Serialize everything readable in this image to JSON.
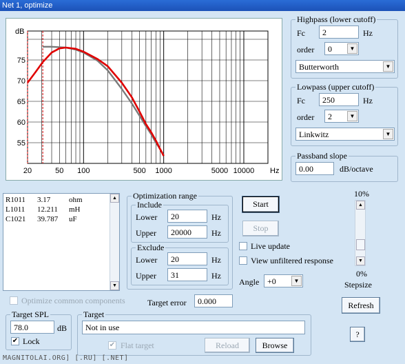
{
  "window": {
    "title": "Net 1, optimize"
  },
  "chart_data": {
    "type": "line",
    "xscale": "log",
    "ylabel": "dB",
    "xlabel": "Hz",
    "xlim": [
      20,
      20000
    ],
    "ylim": [
      50,
      82
    ],
    "x_ticks": [
      "20",
      "50",
      "100",
      "500",
      "1000",
      "5000",
      "10000"
    ],
    "y_ticks": [
      "75",
      "70",
      "65",
      "60",
      "55"
    ],
    "excluded_band_hz": [
      20,
      31
    ],
    "series": [
      {
        "color": "#7a7a7a",
        "x": [
          31,
          40,
          60,
          80,
          100,
          150,
          200,
          300,
          400,
          500,
          600,
          700,
          800,
          900,
          1000
        ],
        "y": [
          78.2,
          78.2,
          78.0,
          77.5,
          76.8,
          74.8,
          72.5,
          68.0,
          64.5,
          61.5,
          59.0,
          57.0,
          55.0,
          53.5,
          52.0
        ]
      },
      {
        "color": "#e00000",
        "x": [
          20,
          25,
          31,
          40,
          50,
          60,
          80,
          100,
          150,
          200,
          300,
          400,
          500,
          600,
          700,
          800,
          900,
          1000
        ],
        "y": [
          69.5,
          72.0,
          74.5,
          76.8,
          77.8,
          78.0,
          77.7,
          77.0,
          75.2,
          73.5,
          69.5,
          66.0,
          62.5,
          59.5,
          57.5,
          55.5,
          53.5,
          51.8
        ]
      }
    ]
  },
  "highpass": {
    "legend": "Highpass (lower cutoff)",
    "fc_label": "Fc",
    "fc_value": "2",
    "fc_unit": "Hz",
    "order_label": "order",
    "order_value": "0",
    "type_value": "Butterworth"
  },
  "lowpass": {
    "legend": "Lowpass (upper cutoff)",
    "fc_label": "Fc",
    "fc_value": "250",
    "fc_unit": "Hz",
    "order_label": "order",
    "order_value": "2",
    "type_value": "Linkwitz"
  },
  "passband": {
    "legend": "Passband slope",
    "value": "0.00",
    "unit": "dB/octave"
  },
  "components": [
    {
      "name": "R1011",
      "value": "3.17",
      "unit": "ohm"
    },
    {
      "name": "L1011",
      "value": "12.211",
      "unit": "mH"
    },
    {
      "name": "C1021",
      "value": "39.787",
      "unit": "uF"
    }
  ],
  "optimization": {
    "legend": "Optimization range",
    "include": {
      "legend": "Include",
      "lower_label": "Lower",
      "lower_value": "20",
      "upper_label": "Upper",
      "upper_value": "20000",
      "unit": "Hz"
    },
    "exclude": {
      "legend": "Exclude",
      "lower_label": "Lower",
      "lower_value": "20",
      "upper_label": "Upper",
      "upper_value": "31",
      "unit": "Hz"
    }
  },
  "controls": {
    "start": "Start",
    "stop": "Stop",
    "live_update": "Live update",
    "view_unfiltered": "View unfiltered response",
    "angle_label": "Angle",
    "angle_value": "+0",
    "step_top": "10%",
    "step_bottom": "0%",
    "stepsize": "Stepsize",
    "step_level": 0.0,
    "refresh": "Refresh",
    "help": "?"
  },
  "optimize_common": "Optimize common components",
  "target_error": {
    "label": "Target error",
    "value": "0.000"
  },
  "target_spl": {
    "legend": "Target SPL",
    "value": "78.0",
    "unit": "dB",
    "lock": "Lock"
  },
  "target": {
    "legend": "Target",
    "value": "Not in use",
    "flat": "Flat target",
    "reload": "Reload",
    "browse": "Browse"
  },
  "watermark": "MAGNITOLAI.ORG] [.RU] [.NET]"
}
